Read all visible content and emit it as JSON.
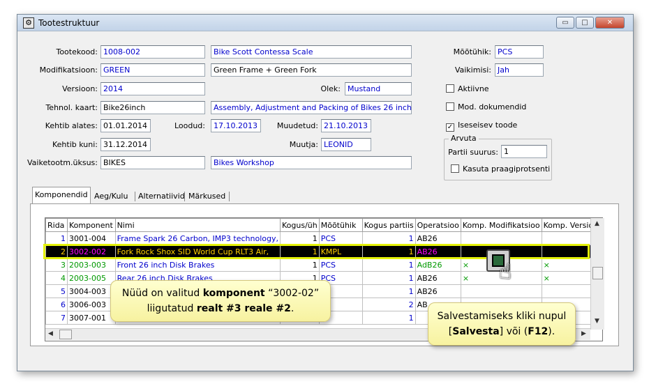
{
  "window": {
    "title": "Tootestruktuur",
    "minimize": "▭",
    "maximize": "□",
    "close": "✕"
  },
  "form": {
    "tootekood_label": "Tootekood:",
    "tootekood": "1008-002",
    "tootekood_desc": "Bike Scott Contessa Scale",
    "modifikatsioon_label": "Modifikatsioon:",
    "modifikatsioon": "GREEN",
    "modifikatsioon_desc": "Green Frame + Green Fork",
    "versioon_label": "Versioon:",
    "versioon": "2014",
    "olek_label": "Olek:",
    "olek": "Mustand",
    "tehnol_label": "Tehnol. kaart:",
    "tehnol": "Bike26inch",
    "tehnol_desc": "Assembly, Adjustment and Packing of Bikes 26 inch",
    "kehtib_alates_label": "Kehtib alates:",
    "kehtib_alates": "01.01.2014",
    "loodud_label": "Loodud:",
    "loodud": "17.10.2013",
    "muudetud_label": "Muudetud:",
    "muudetud": "21.10.2013",
    "kehtib_kuni_label": "Kehtib kuni:",
    "kehtib_kuni": "31.12.2014",
    "muutja_label": "Muutja:",
    "muutja": "LEONID",
    "vaiketootm_label": "Vaiketootm.üksus:",
    "vaiketootm": "BIKES",
    "vaiketootm_desc": "Bikes Workshop",
    "mootuhik_label": "Mõõtühik:",
    "mootuhik": "PCS",
    "vaikimisi_label": "Vaikimisi:",
    "vaikimisi": "Jah",
    "aktiivne_label": "Aktiivne",
    "mod_dok_label": "Mod. dokumendid",
    "iseseisev_label": "Iseseisev toode",
    "check_mark": "✓",
    "arvuta_label": "Arvuta",
    "partii_label": "Partii suurus:",
    "partii": "1",
    "kasuta_label": "Kasuta praagiprotsenti"
  },
  "tabs": [
    "Komponendid",
    "Aeg/Kulu",
    "Alternatiivid",
    "Märkused"
  ],
  "grid": {
    "headers": [
      "Rida",
      "Komponent",
      "Nimi",
      "Kogus/üh",
      "Mõõtühik",
      "Kogus partiis",
      "Operatsioo",
      "Komp. Modifikatsioo",
      "Komp. Versiooi"
    ],
    "rows": [
      [
        "1",
        "3001-004",
        "Frame Spark 26 Carbon, IMP3 technology,",
        "1",
        "PCS",
        "1",
        "AB26",
        "",
        ""
      ],
      [
        "2",
        "3002-002",
        "Fork Rock Shox SID World Cup RLT3 Air,",
        "1",
        "KMPL",
        "1",
        "AB26",
        "",
        ""
      ],
      [
        "3",
        "2003-003",
        "Front  26 inch Disk Brakes",
        "1",
        "PCS",
        "1",
        "AdB26",
        "×",
        "×"
      ],
      [
        "4",
        "2003-005",
        "Rear  26 inch Disk Brakes",
        "1",
        "PCS",
        "1",
        "AB26",
        "×",
        "×"
      ],
      [
        "5",
        "3004-003",
        "",
        "",
        "",
        "1",
        "AB26",
        "",
        ""
      ],
      [
        "6",
        "3006-003",
        "",
        "",
        "",
        "2",
        "AB",
        "",
        ""
      ],
      [
        "7",
        "3007-001",
        "",
        "",
        "",
        "1",
        "",
        "",
        ""
      ]
    ]
  },
  "callout1": {
    "prefix": "Nüüd on valitud ",
    "bold1": "komponent",
    "middle": " “3002-02”",
    "line2_prefix": "liigutatud ",
    "bold2": "realt #3 reale #2",
    "line2_suffix": "."
  },
  "callout2": {
    "line1": "Salvestamiseks kliki nupul",
    "open": "[",
    "bold1": "Salvesta",
    "mid": "] või (",
    "bold2": "F12",
    "close": ")."
  },
  "icons": {
    "save": "save-icon",
    "hand": "☝"
  }
}
